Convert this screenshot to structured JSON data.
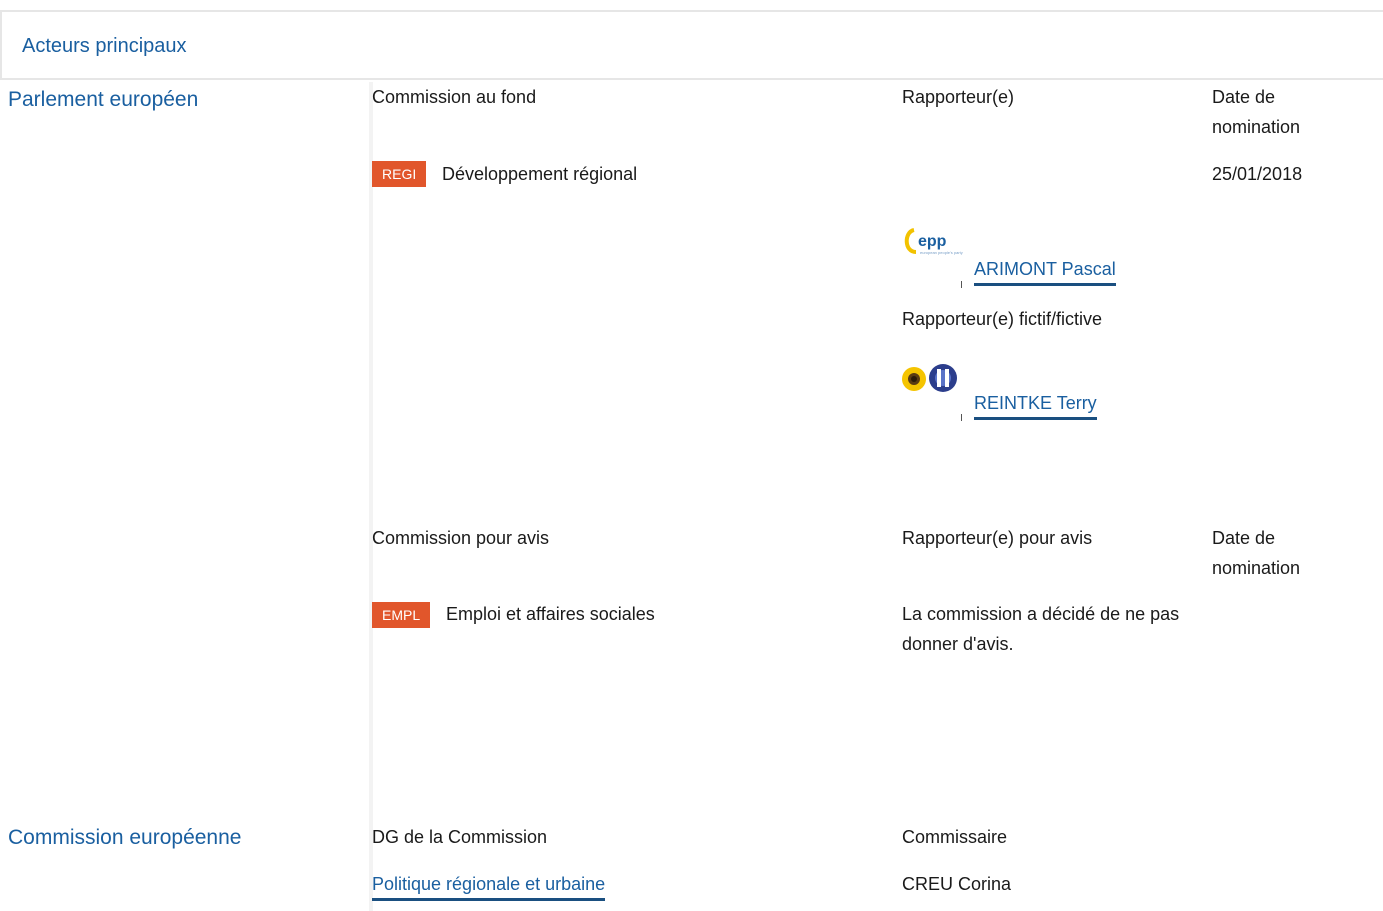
{
  "header": {
    "title": "Acteurs principaux"
  },
  "parliament": {
    "label": "Parlement européen",
    "lead": {
      "committee_header": "Commission au fond",
      "rapporteur_header": "Rapporteur(e)",
      "date_header": "Date de nomination",
      "committee_code": "REGI",
      "committee_name": "Développement régional",
      "date": "25/01/2018",
      "rapporteur_name": "ARIMONT Pascal",
      "rapporteur_group_logo": "epp-logo",
      "shadow_header": "Rapporteur(e) fictif/fictive",
      "shadow_name": "REINTKE Terry",
      "shadow_group_logo": "greens-efa-logo"
    },
    "opinion": {
      "committee_header": "Commission pour avis",
      "rapporteur_header": "Rapporteur(e) pour avis",
      "date_header": "Date de nomination",
      "committee_code": "EMPL",
      "committee_name": "Emploi et affaires sociales",
      "decision": "La commission a décidé de ne pas donner d'avis."
    }
  },
  "commission": {
    "label": "Commission européenne",
    "dg_header": "DG de la Commission",
    "commissioner_header": "Commissaire",
    "dg_name": "Politique régionale et urbaine",
    "commissioner_name": "CREU Corina"
  },
  "colors": {
    "accent_blue": "#1a5fa0",
    "badge_orange": "#e1562b"
  }
}
